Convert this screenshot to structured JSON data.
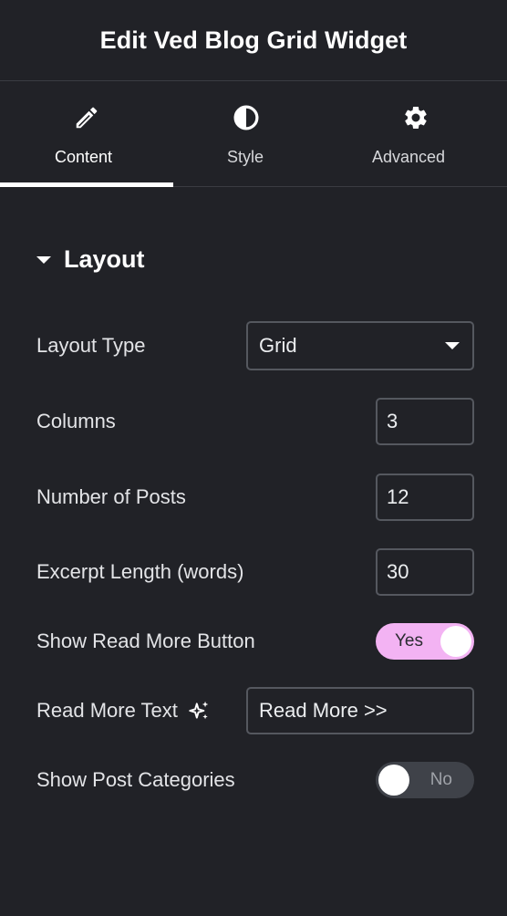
{
  "panel": {
    "title": "Edit Ved Blog Grid Widget"
  },
  "tabs": [
    {
      "label": "Content",
      "icon": "pencil-icon",
      "active": true
    },
    {
      "label": "Style",
      "icon": "half-circle-icon",
      "active": false
    },
    {
      "label": "Advanced",
      "icon": "gear-icon",
      "active": false
    }
  ],
  "section": {
    "title": "Layout",
    "expanded": true
  },
  "fields": {
    "layout_type": {
      "label": "Layout Type",
      "value": "Grid"
    },
    "columns": {
      "label": "Columns",
      "value": "3"
    },
    "num_posts": {
      "label": "Number of Posts",
      "value": "12"
    },
    "excerpt_length": {
      "label": "Excerpt Length (words)",
      "value": "30"
    },
    "show_read_more": {
      "label": "Show Read More Button",
      "state": "Yes"
    },
    "read_more_text": {
      "label": "Read More Text",
      "value": "Read More >>"
    },
    "show_categories": {
      "label": "Show Post Categories",
      "state": "No"
    }
  },
  "colors": {
    "background": "#212227",
    "toggle_on": "#f3b3f3",
    "toggle_off": "#3f4249",
    "border": "#55585f"
  }
}
